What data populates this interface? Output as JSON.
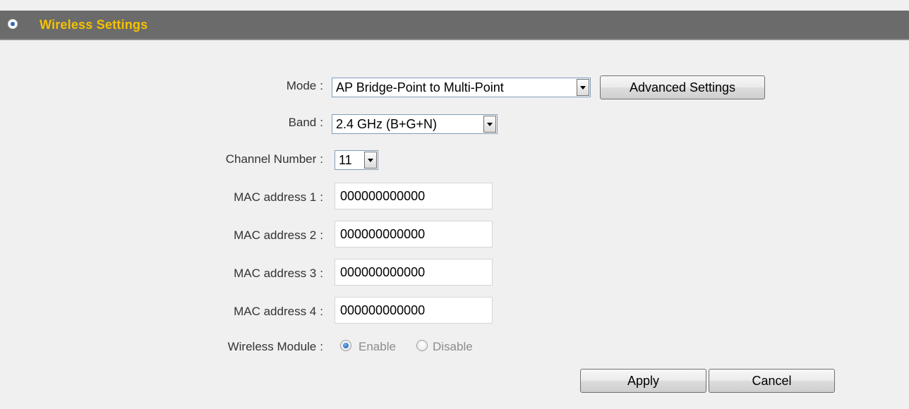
{
  "title": "Wireless Settings",
  "colon": ":",
  "colors": {
    "title_bar": "#6b6b6b",
    "title_text": "#f5c200",
    "panel_bg": "#f0f0f0"
  },
  "form": {
    "mode": {
      "label": "Mode",
      "value": "AP Bridge-Point to Multi-Point",
      "advanced_button": "Advanced Settings"
    },
    "band": {
      "label": "Band",
      "value": "2.4 GHz (B+G+N)"
    },
    "channel": {
      "label": "Channel Number",
      "value": "11"
    },
    "mac": [
      {
        "label": "MAC address 1",
        "value": "000000000000"
      },
      {
        "label": "MAC address 2",
        "value": "000000000000"
      },
      {
        "label": "MAC address 3",
        "value": "000000000000"
      },
      {
        "label": "MAC address 4",
        "value": "000000000000"
      }
    ],
    "wireless_module": {
      "label": "Wireless Module",
      "enable": "Enable",
      "disable": "Disable",
      "selected": "Enable"
    }
  },
  "buttons": {
    "apply": "Apply",
    "cancel": "Cancel"
  }
}
